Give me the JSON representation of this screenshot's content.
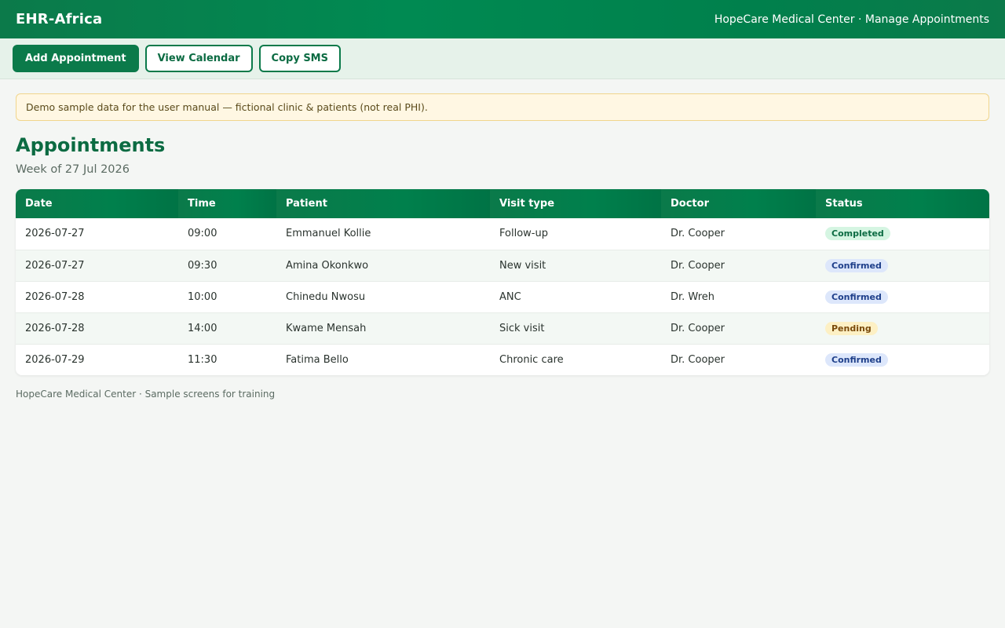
{
  "header": {
    "brand": "EHR-Africa",
    "context": "HopeCare Medical Center · Manage Appointments"
  },
  "toolbar": {
    "add_label": "Add Appointment",
    "calendar_label": "View Calendar",
    "sms_label": "Copy SMS"
  },
  "notice": {
    "text": "Demo sample data for the user manual — fictional clinic & patients (not real PHI)."
  },
  "main": {
    "title": "Appointments",
    "subtitle": "Week of 27 Jul 2026"
  },
  "table": {
    "columns": [
      "Date",
      "Time",
      "Patient",
      "Visit type",
      "Doctor",
      "Status"
    ],
    "rows": [
      {
        "date": "2026-07-27",
        "time": "09:00",
        "patient": "Emmanuel Kollie",
        "visit_type": "Follow-up",
        "doctor": "Dr. Cooper",
        "status": "Completed"
      },
      {
        "date": "2026-07-27",
        "time": "09:30",
        "patient": "Amina Okonkwo",
        "visit_type": "New visit",
        "doctor": "Dr. Cooper",
        "status": "Confirmed"
      },
      {
        "date": "2026-07-28",
        "time": "10:00",
        "patient": "Chinedu Nwosu",
        "visit_type": "ANC",
        "doctor": "Dr. Wreh",
        "status": "Confirmed"
      },
      {
        "date": "2026-07-28",
        "time": "14:00",
        "patient": "Kwame Mensah",
        "visit_type": "Sick visit",
        "doctor": "Dr. Cooper",
        "status": "Pending"
      },
      {
        "date": "2026-07-29",
        "time": "11:30",
        "patient": "Fatima Bello",
        "visit_type": "Chronic care",
        "doctor": "Dr. Cooper",
        "status": "Confirmed"
      }
    ]
  },
  "footer": {
    "text": "HopeCare Medical Center · Sample screens for training"
  },
  "colors": {
    "brand_green": "#0b7a4a",
    "status_completed": "#d5f5e2",
    "status_confirmed": "#dde7fb",
    "status_pending": "#fdf0c4"
  }
}
